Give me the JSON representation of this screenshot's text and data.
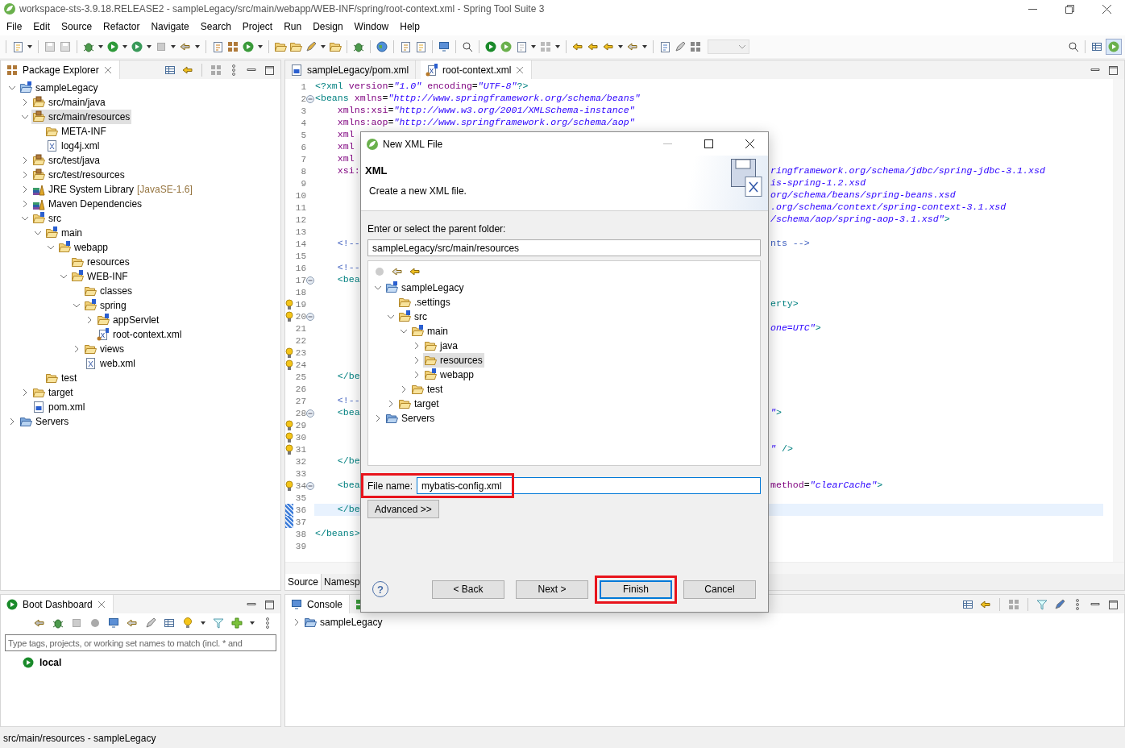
{
  "window": {
    "title": "workspace-sts-3.9.18.RELEASE2 - sampleLegacy/src/main/webapp/WEB-INF/spring/root-context.xml - Spring Tool Suite 3"
  },
  "menu": [
    "File",
    "Edit",
    "Source",
    "Refactor",
    "Navigate",
    "Search",
    "Project",
    "Run",
    "Design",
    "Window",
    "Help"
  ],
  "package_explorer": {
    "title": "Package Explorer",
    "tree": [
      {
        "label": "sampleLegacy",
        "kind": "project",
        "expanded": true,
        "selected": false,
        "children": [
          {
            "label": "src/main/java",
            "kind": "pkgroot",
            "expanded": false,
            "selected": false
          },
          {
            "label": "src/main/resources",
            "kind": "pkgroot",
            "expanded": true,
            "selected": true,
            "children": [
              {
                "label": "META-INF",
                "kind": "folder",
                "selected": false
              },
              {
                "label": "log4j.xml",
                "kind": "xml",
                "selected": false
              }
            ]
          },
          {
            "label": "src/test/java",
            "kind": "pkgroot",
            "expanded": false,
            "selected": false
          },
          {
            "label": "src/test/resources",
            "kind": "pkgroot",
            "expanded": false,
            "selected": false
          },
          {
            "label": "JRE System Library",
            "decoration": "[JavaSE-1.6]",
            "kind": "library",
            "expanded": false,
            "selected": false
          },
          {
            "label": "Maven Dependencies",
            "kind": "library",
            "expanded": false,
            "selected": false
          },
          {
            "label": "src",
            "kind": "spring-folder",
            "expanded": true,
            "selected": false,
            "children": [
              {
                "label": "main",
                "kind": "spring-folder",
                "expanded": true,
                "selected": false,
                "children": [
                  {
                    "label": "webapp",
                    "kind": "spring-folder",
                    "expanded": true,
                    "selected": false,
                    "children": [
                      {
                        "label": "resources",
                        "kind": "folder",
                        "selected": false
                      },
                      {
                        "label": "WEB-INF",
                        "kind": "spring-folder",
                        "expanded": true,
                        "selected": false,
                        "children": [
                          {
                            "label": "classes",
                            "kind": "folder",
                            "selected": false
                          },
                          {
                            "label": "spring",
                            "kind": "spring-folder",
                            "expanded": true,
                            "selected": false,
                            "children": [
                              {
                                "label": "appServlet",
                                "kind": "spring-folder",
                                "expanded": false,
                                "selected": false
                              },
                              {
                                "label": "root-context.xml",
                                "kind": "spring-xml",
                                "selected": false
                              }
                            ]
                          },
                          {
                            "label": "views",
                            "kind": "folder",
                            "expanded": false,
                            "selected": false
                          },
                          {
                            "label": "web.xml",
                            "kind": "xml",
                            "selected": false
                          }
                        ]
                      }
                    ]
                  }
                ]
              },
              {
                "label": "test",
                "kind": "folder",
                "selected": false
              }
            ]
          },
          {
            "label": "target",
            "kind": "folder",
            "expanded": false,
            "selected": false
          },
          {
            "label": "pom.xml",
            "kind": "pom",
            "selected": false
          }
        ]
      },
      {
        "label": "Servers",
        "kind": "servers",
        "expanded": false,
        "selected": false
      }
    ]
  },
  "editor": {
    "tabs": [
      {
        "label": "sampleLegacy/pom.xml",
        "kind": "pom",
        "selected": false
      },
      {
        "label": "root-context.xml",
        "kind": "spring-xml",
        "selected": true
      }
    ],
    "lines": [
      {
        "n": "1",
        "fold": false,
        "bulb": false,
        "marker": false,
        "current": false,
        "left": [
          {
            "t": "<?xml ",
            "kind": "tag"
          },
          {
            "t": "version",
            "kind": "attr"
          },
          {
            "t": "=",
            "kind": "text"
          },
          {
            "t": "\"1.0\"",
            "kind": "str"
          },
          {
            "t": " encoding",
            "kind": "attr"
          },
          {
            "t": "=",
            "kind": "text"
          },
          {
            "t": "\"UTF-8\"",
            "kind": "str"
          },
          {
            "t": "?>",
            "kind": "tag"
          }
        ]
      },
      {
        "n": "2",
        "fold": true,
        "bulb": false,
        "marker": false,
        "current": false,
        "left": [
          {
            "t": "<beans",
            "kind": "tag"
          },
          {
            "t": " xmlns",
            "kind": "attr"
          },
          {
            "t": "=",
            "kind": "text"
          },
          {
            "t": "\"http://www.springframework.org/schema/beans\"",
            "kind": "str"
          }
        ]
      },
      {
        "n": "3",
        "fold": false,
        "bulb": false,
        "marker": false,
        "current": false,
        "left": [
          {
            "t": "    xmlns:xsi",
            "kind": "attr"
          },
          {
            "t": "=",
            "kind": "text"
          },
          {
            "t": "\"http://www.w3.org/2001/XMLSchema-instance\"",
            "kind": "str"
          }
        ]
      },
      {
        "n": "4",
        "fold": false,
        "bulb": false,
        "marker": false,
        "current": false,
        "left": [
          {
            "t": "    xmlns:aop",
            "kind": "attr"
          },
          {
            "t": "=",
            "kind": "text"
          },
          {
            "t": "\"http://www.springframework.org/schema/aop\"",
            "kind": "str"
          }
        ]
      },
      {
        "n": "5",
        "fold": false,
        "bulb": false,
        "marker": false,
        "current": false,
        "left": [
          {
            "t": "    xml",
            "kind": "attr"
          }
        ]
      },
      {
        "n": "6",
        "fold": false,
        "bulb": false,
        "marker": false,
        "current": false,
        "left": [
          {
            "t": "    xml",
            "kind": "attr"
          }
        ]
      },
      {
        "n": "7",
        "fold": false,
        "bulb": false,
        "marker": false,
        "current": false,
        "left": [
          {
            "t": "    xml",
            "kind": "attr"
          }
        ]
      },
      {
        "n": "8",
        "fold": false,
        "bulb": false,
        "marker": false,
        "current": false,
        "left": [
          {
            "t": "    xsi:",
            "kind": "attr"
          }
        ],
        "right": [
          {
            "t": "ringframework.org/schema/jdbc/spring-jdbc-3.1.xsd",
            "kind": "str"
          }
        ]
      },
      {
        "n": "9",
        "fold": false,
        "bulb": false,
        "marker": false,
        "current": false,
        "right": [
          {
            "t": "is-spring-1.2.xsd",
            "kind": "str"
          }
        ]
      },
      {
        "n": "10",
        "fold": false,
        "bulb": false,
        "marker": false,
        "current": false,
        "right": [
          {
            "t": "org/schema/beans/spring-beans.xsd",
            "kind": "str"
          }
        ]
      },
      {
        "n": "11",
        "fold": false,
        "bulb": false,
        "marker": false,
        "current": false,
        "right": [
          {
            "t": ".org/schema/context/spring-context-3.1.xsd",
            "kind": "str"
          }
        ]
      },
      {
        "n": "12",
        "fold": false,
        "bulb": false,
        "marker": false,
        "current": false,
        "right": [
          {
            "t": "/schema/aop/spring-aop-3.1.xsd\"",
            "kind": "str"
          },
          {
            "t": ">",
            "kind": "tag"
          }
        ]
      },
      {
        "n": "13",
        "fold": false,
        "bulb": false,
        "marker": false,
        "current": false
      },
      {
        "n": "14",
        "fold": false,
        "bulb": false,
        "marker": false,
        "current": false,
        "left": [
          {
            "t": "    <!--",
            "kind": "com"
          }
        ],
        "right": [
          {
            "t": "nts -->",
            "kind": "com"
          }
        ]
      },
      {
        "n": "15",
        "fold": false,
        "bulb": false,
        "marker": false,
        "current": false
      },
      {
        "n": "16",
        "fold": false,
        "bulb": false,
        "marker": false,
        "current": false,
        "left": [
          {
            "t": "    <!--",
            "kind": "com"
          }
        ]
      },
      {
        "n": "17",
        "fold": true,
        "bulb": false,
        "marker": false,
        "current": false,
        "left": [
          {
            "t": "    <bea",
            "kind": "tag"
          }
        ]
      },
      {
        "n": "18",
        "fold": false,
        "bulb": false,
        "marker": false,
        "current": false
      },
      {
        "n": "19",
        "fold": false,
        "bulb": true,
        "marker": false,
        "current": false,
        "right": [
          {
            "t": "erty>",
            "kind": "tag"
          }
        ]
      },
      {
        "n": "20",
        "fold": true,
        "bulb": true,
        "marker": false,
        "current": false
      },
      {
        "n": "21",
        "fold": false,
        "bulb": false,
        "marker": false,
        "current": false,
        "right": [
          {
            "t": "one=UTC\"",
            "kind": "str"
          },
          {
            "t": ">",
            "kind": "tag"
          }
        ]
      },
      {
        "n": "22",
        "fold": false,
        "bulb": false,
        "marker": false,
        "current": false
      },
      {
        "n": "23",
        "fold": false,
        "bulb": true,
        "marker": false,
        "current": false
      },
      {
        "n": "24",
        "fold": false,
        "bulb": true,
        "marker": false,
        "current": false
      },
      {
        "n": "25",
        "fold": false,
        "bulb": false,
        "marker": false,
        "current": false,
        "left": [
          {
            "t": "    </be",
            "kind": "tag"
          }
        ]
      },
      {
        "n": "26",
        "fold": false,
        "bulb": false,
        "marker": false,
        "current": false
      },
      {
        "n": "27",
        "fold": false,
        "bulb": false,
        "marker": false,
        "current": false,
        "left": [
          {
            "t": "    <!--",
            "kind": "com"
          }
        ]
      },
      {
        "n": "28",
        "fold": true,
        "bulb": false,
        "marker": false,
        "current": false,
        "left": [
          {
            "t": "    <bea",
            "kind": "tag"
          }
        ],
        "right": [
          {
            "t": "\"",
            "kind": "str"
          },
          {
            "t": ">",
            "kind": "tag"
          }
        ]
      },
      {
        "n": "29",
        "fold": false,
        "bulb": true,
        "marker": false,
        "current": false
      },
      {
        "n": "30",
        "fold": false,
        "bulb": true,
        "marker": false,
        "current": false
      },
      {
        "n": "31",
        "fold": false,
        "bulb": true,
        "marker": false,
        "current": false,
        "right": [
          {
            "t": "\"",
            "kind": "str"
          },
          {
            "t": " />",
            "kind": "tag"
          }
        ]
      },
      {
        "n": "32",
        "fold": false,
        "bulb": false,
        "marker": false,
        "current": false,
        "left": [
          {
            "t": "    </be",
            "kind": "tag"
          }
        ]
      },
      {
        "n": "33",
        "fold": false,
        "bulb": false,
        "marker": false,
        "current": false
      },
      {
        "n": "34",
        "fold": true,
        "bulb": true,
        "marker": false,
        "current": false,
        "left": [
          {
            "t": "    <bea",
            "kind": "tag"
          }
        ],
        "right": [
          {
            "t": "method",
            "kind": "attr"
          },
          {
            "t": "=",
            "kind": "text"
          },
          {
            "t": "\"clearCache\"",
            "kind": "str"
          },
          {
            "t": ">",
            "kind": "tag"
          }
        ]
      },
      {
        "n": "35",
        "fold": false,
        "bulb": false,
        "marker": false,
        "current": false
      },
      {
        "n": "36",
        "fold": false,
        "bulb": false,
        "marker": true,
        "current": true,
        "left": [
          {
            "t": "    </be",
            "kind": "tag"
          }
        ]
      },
      {
        "n": "37",
        "fold": false,
        "bulb": false,
        "marker": true,
        "current": false
      },
      {
        "n": "38",
        "fold": false,
        "bulb": false,
        "marker": false,
        "current": false,
        "left": [
          {
            "t": "</beans>",
            "kind": "tag"
          }
        ]
      },
      {
        "n": "39",
        "fold": false,
        "bulb": false,
        "marker": false,
        "current": false
      }
    ],
    "bottom_tabs": [
      {
        "label": "Source",
        "selected": true
      },
      {
        "label": "Namesp",
        "selected": false
      }
    ]
  },
  "boot_dashboard": {
    "title": "Boot Dashboard",
    "filter": {
      "placeholder": "Type tags, projects, or working set names to match (incl. * and"
    },
    "items": [
      {
        "label": "local"
      }
    ]
  },
  "console": {
    "title": "Console",
    "tree": [
      {
        "label": "sampleLegacy",
        "kind": "servers",
        "expanded": false,
        "selected": false
      }
    ]
  },
  "status_bar": "src/main/resources - sampleLegacy",
  "dialog": {
    "title": "New XML File",
    "heading": "XML",
    "description": "Create a new XML file.",
    "folder_label": "Enter or select the parent folder:",
    "folder_value": "sampleLegacy/src/main/resources",
    "tree": [
      {
        "label": "sampleLegacy",
        "kind": "project",
        "expanded": true,
        "selected": false,
        "children": [
          {
            "label": ".settings",
            "kind": "folder",
            "selected": false
          },
          {
            "label": "src",
            "kind": "spring-folder",
            "expanded": true,
            "selected": false,
            "children": [
              {
                "label": "main",
                "kind": "spring-folder",
                "expanded": true,
                "selected": false,
                "children": [
                  {
                    "label": "java",
                    "kind": "folder",
                    "expanded": false,
                    "selected": false
                  },
                  {
                    "label": "resources",
                    "kind": "folder",
                    "expanded": false,
                    "selected": true
                  },
                  {
                    "label": "webapp",
                    "kind": "spring-folder",
                    "expanded": false,
                    "selected": false
                  }
                ]
              },
              {
                "label": "test",
                "kind": "folder",
                "expanded": false,
                "selected": false
              }
            ]
          },
          {
            "label": "target",
            "kind": "folder",
            "expanded": false,
            "selected": false
          }
        ]
      },
      {
        "label": "Servers",
        "kind": "servers",
        "expanded": false,
        "selected": false
      }
    ],
    "file_name": {
      "label": "File name:",
      "value": "mybatis-config.xml",
      "highlighted": true
    },
    "advanced": "Advanced >>",
    "help": "?",
    "buttons": [
      {
        "label": "< Back",
        "default": false,
        "highlighted": false
      },
      {
        "label": "Next >",
        "default": false,
        "highlighted": false
      },
      {
        "label": "Finish",
        "default": true,
        "highlighted": true
      },
      {
        "label": "Cancel",
        "default": false,
        "highlighted": false
      }
    ]
  }
}
